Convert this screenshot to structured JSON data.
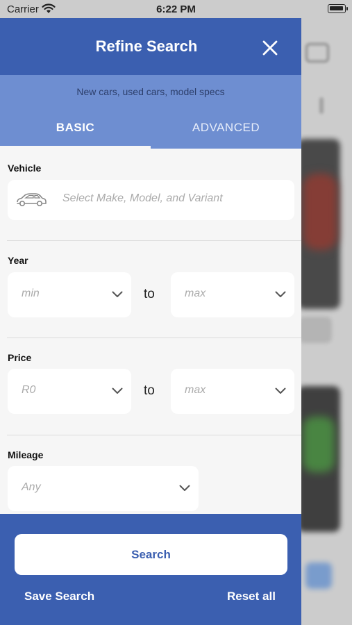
{
  "status_bar": {
    "carrier": "Carrier",
    "time": "6:22 PM"
  },
  "header": {
    "title": "Refine Search"
  },
  "subtitle": "New cars, used cars, model specs",
  "tabs": [
    {
      "label": "BASIC",
      "active": true
    },
    {
      "label": "ADVANCED",
      "active": false
    }
  ],
  "vehicle": {
    "label": "Vehicle",
    "placeholder": "Select Make, Model, and Variant"
  },
  "year": {
    "label": "Year",
    "min_placeholder": "min",
    "to": "to",
    "max_placeholder": "max"
  },
  "price": {
    "label": "Price",
    "min_placeholder": "R0",
    "to": "to",
    "max_placeholder": "max"
  },
  "mileage": {
    "label": "Mileage",
    "placeholder": "Any"
  },
  "footer": {
    "search_label": "Search",
    "save_search_label": "Save Search",
    "reset_all_label": "Reset all"
  },
  "colors": {
    "primary": "#3b5fb0",
    "secondary": "#6e8ed1",
    "panel_bg": "#f6f6f6"
  },
  "icons": [
    "wifi-icon",
    "battery-icon",
    "close-icon",
    "car-icon",
    "chevron-down-icon"
  ]
}
